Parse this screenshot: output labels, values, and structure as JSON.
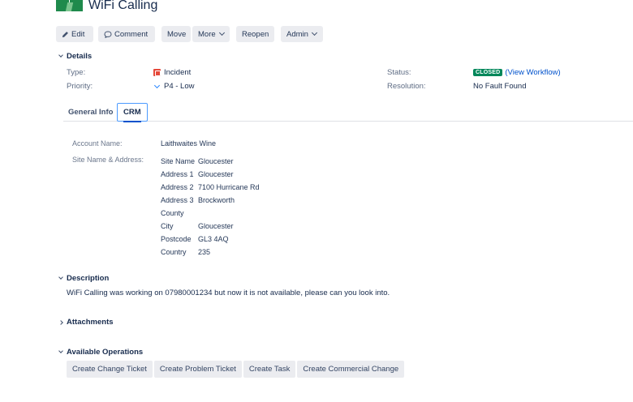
{
  "header": {
    "title": "WiFi Calling"
  },
  "toolbar": {
    "edit": "Edit",
    "comment": "Comment",
    "move": "Move",
    "more": "More",
    "reopen": "Reopen",
    "admin": "Admin"
  },
  "details": {
    "heading": "Details",
    "type_label": "Type:",
    "type_value": "Incident",
    "priority_label": "Priority:",
    "priority_value": "P4 - Low",
    "status_label": "Status:",
    "status_value": "CLOSED",
    "view_workflow": "(View Workflow)",
    "resolution_label": "Resolution:",
    "resolution_value": "No Fault Found"
  },
  "tabs": {
    "general": "General Info",
    "crm": "CRM"
  },
  "crm": {
    "account_label": "Account Name:",
    "account_value": "Laithwaites Wine",
    "site_label": "Site Name & Address:",
    "address": [
      {
        "key": "Site Name",
        "value": "Gloucester"
      },
      {
        "key": "Address 1",
        "value": "Gloucester"
      },
      {
        "key": "Address 2",
        "value": "7100 Hurricane Rd"
      },
      {
        "key": "Address 3",
        "value": "Brockworth"
      },
      {
        "key": "County",
        "value": ""
      },
      {
        "key": "City",
        "value": "Gloucester"
      },
      {
        "key": "Postcode",
        "value": "GL3 4AQ"
      },
      {
        "key": "Country",
        "value": "235"
      }
    ]
  },
  "description": {
    "heading": "Description",
    "text": "WiFi Calling was working on 07980001234 but now it is not available, please can you look into."
  },
  "attachments": {
    "heading": "Attachments"
  },
  "operations": {
    "heading": "Available Operations",
    "buttons": [
      "Create Change Ticket",
      "Create Problem Ticket",
      "Create Task",
      "Create Commercial Change"
    ]
  },
  "colors": {
    "status_closed": "#00875a",
    "link": "#0052cc",
    "brand": "#1f8a4c",
    "incident": "#e5493a"
  }
}
